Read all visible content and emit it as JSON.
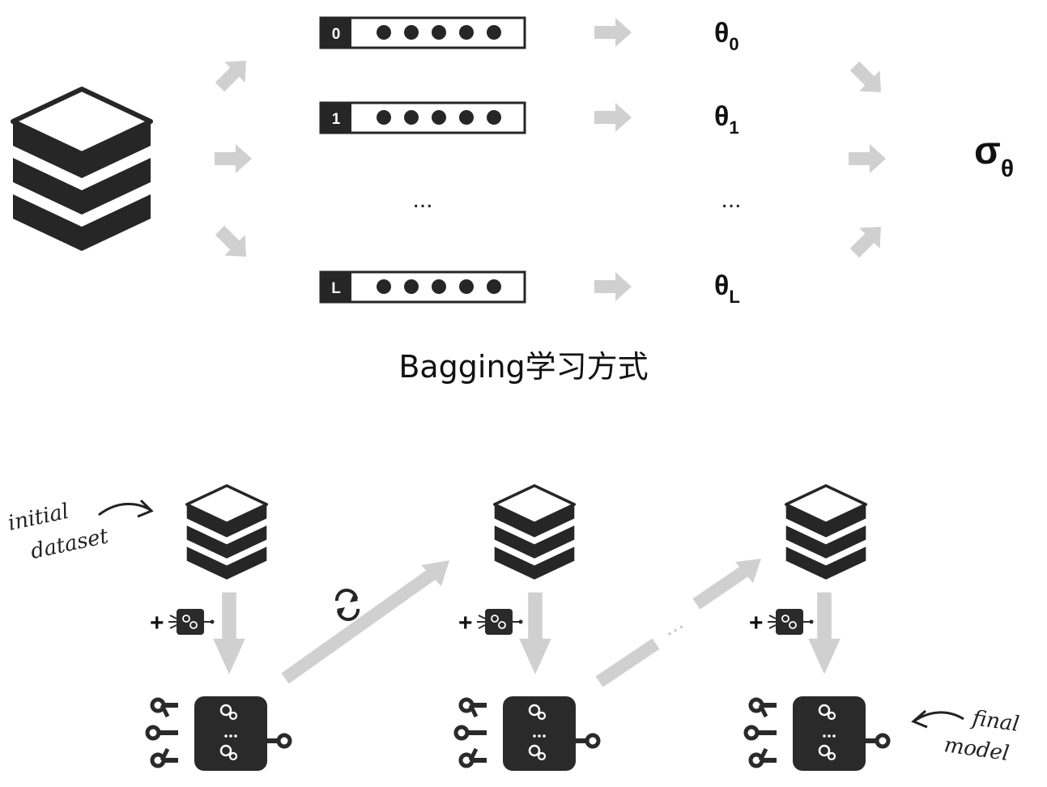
{
  "bagging": {
    "bootstrap_rows": [
      {
        "index": "0",
        "theta": "θ",
        "theta_sub": "0"
      },
      {
        "index": "1",
        "theta": "θ",
        "theta_sub": "1"
      },
      {
        "index": "L",
        "theta": "θ",
        "theta_sub": "L"
      }
    ],
    "ellipsis_left": "...",
    "ellipsis_right": "...",
    "result": "σ",
    "result_sub": "θ"
  },
  "caption": "Bagging学习方式",
  "boosting": {
    "initial_label_line1": "initial",
    "initial_label_line2": "dataset",
    "weak_learner_prefix": "+",
    "ellipsis": "...",
    "final_label_line1": "final",
    "final_label_line2": "model"
  },
  "colors": {
    "stack_dark": "#262626",
    "arrow_gray": "#d0d0d0",
    "model_box": "#2a2a2a"
  }
}
